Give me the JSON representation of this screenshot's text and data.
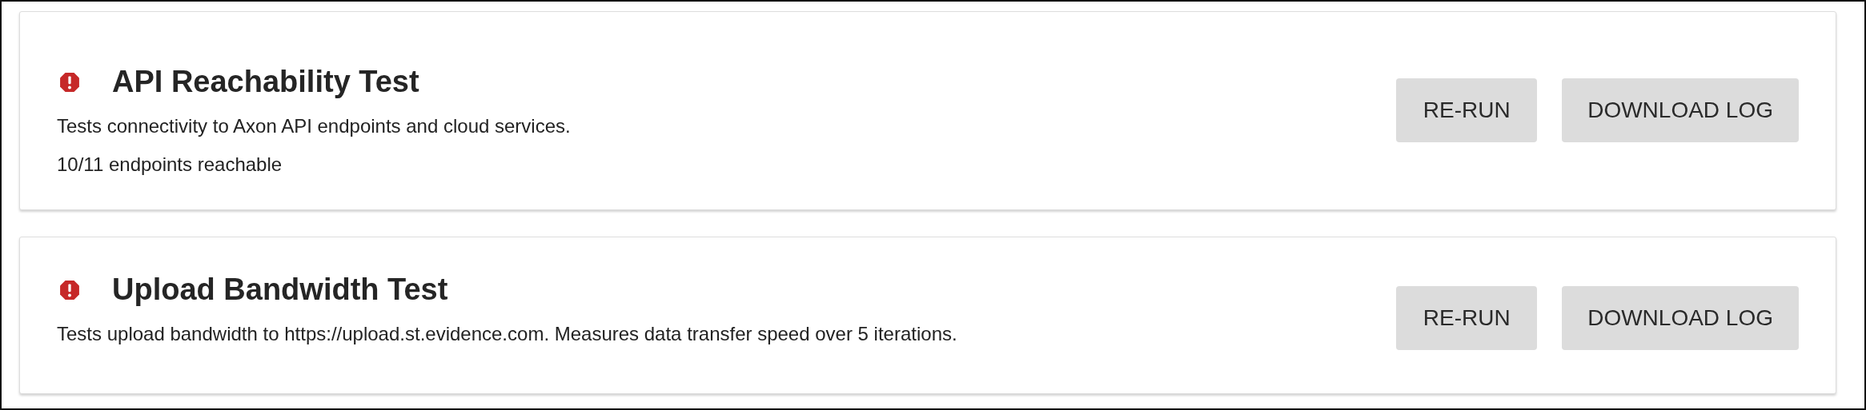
{
  "tests": [
    {
      "failed": true,
      "title": "API Reachability Test",
      "description": "Tests connectivity to Axon API endpoints and cloud services.",
      "result": "10/11 endpoints reachable",
      "buttons": [
        "RE-RUN",
        "DOWNLOAD LOG"
      ]
    },
    {
      "failed": true,
      "title": "Upload Bandwidth Test",
      "description": "Tests upload bandwidth to https://upload.st.evidence.com. Measures data transfer speed over 5 iterations.",
      "buttons": [
        "RE-RUN",
        "DOWNLOAD LOG"
      ]
    }
  ]
}
